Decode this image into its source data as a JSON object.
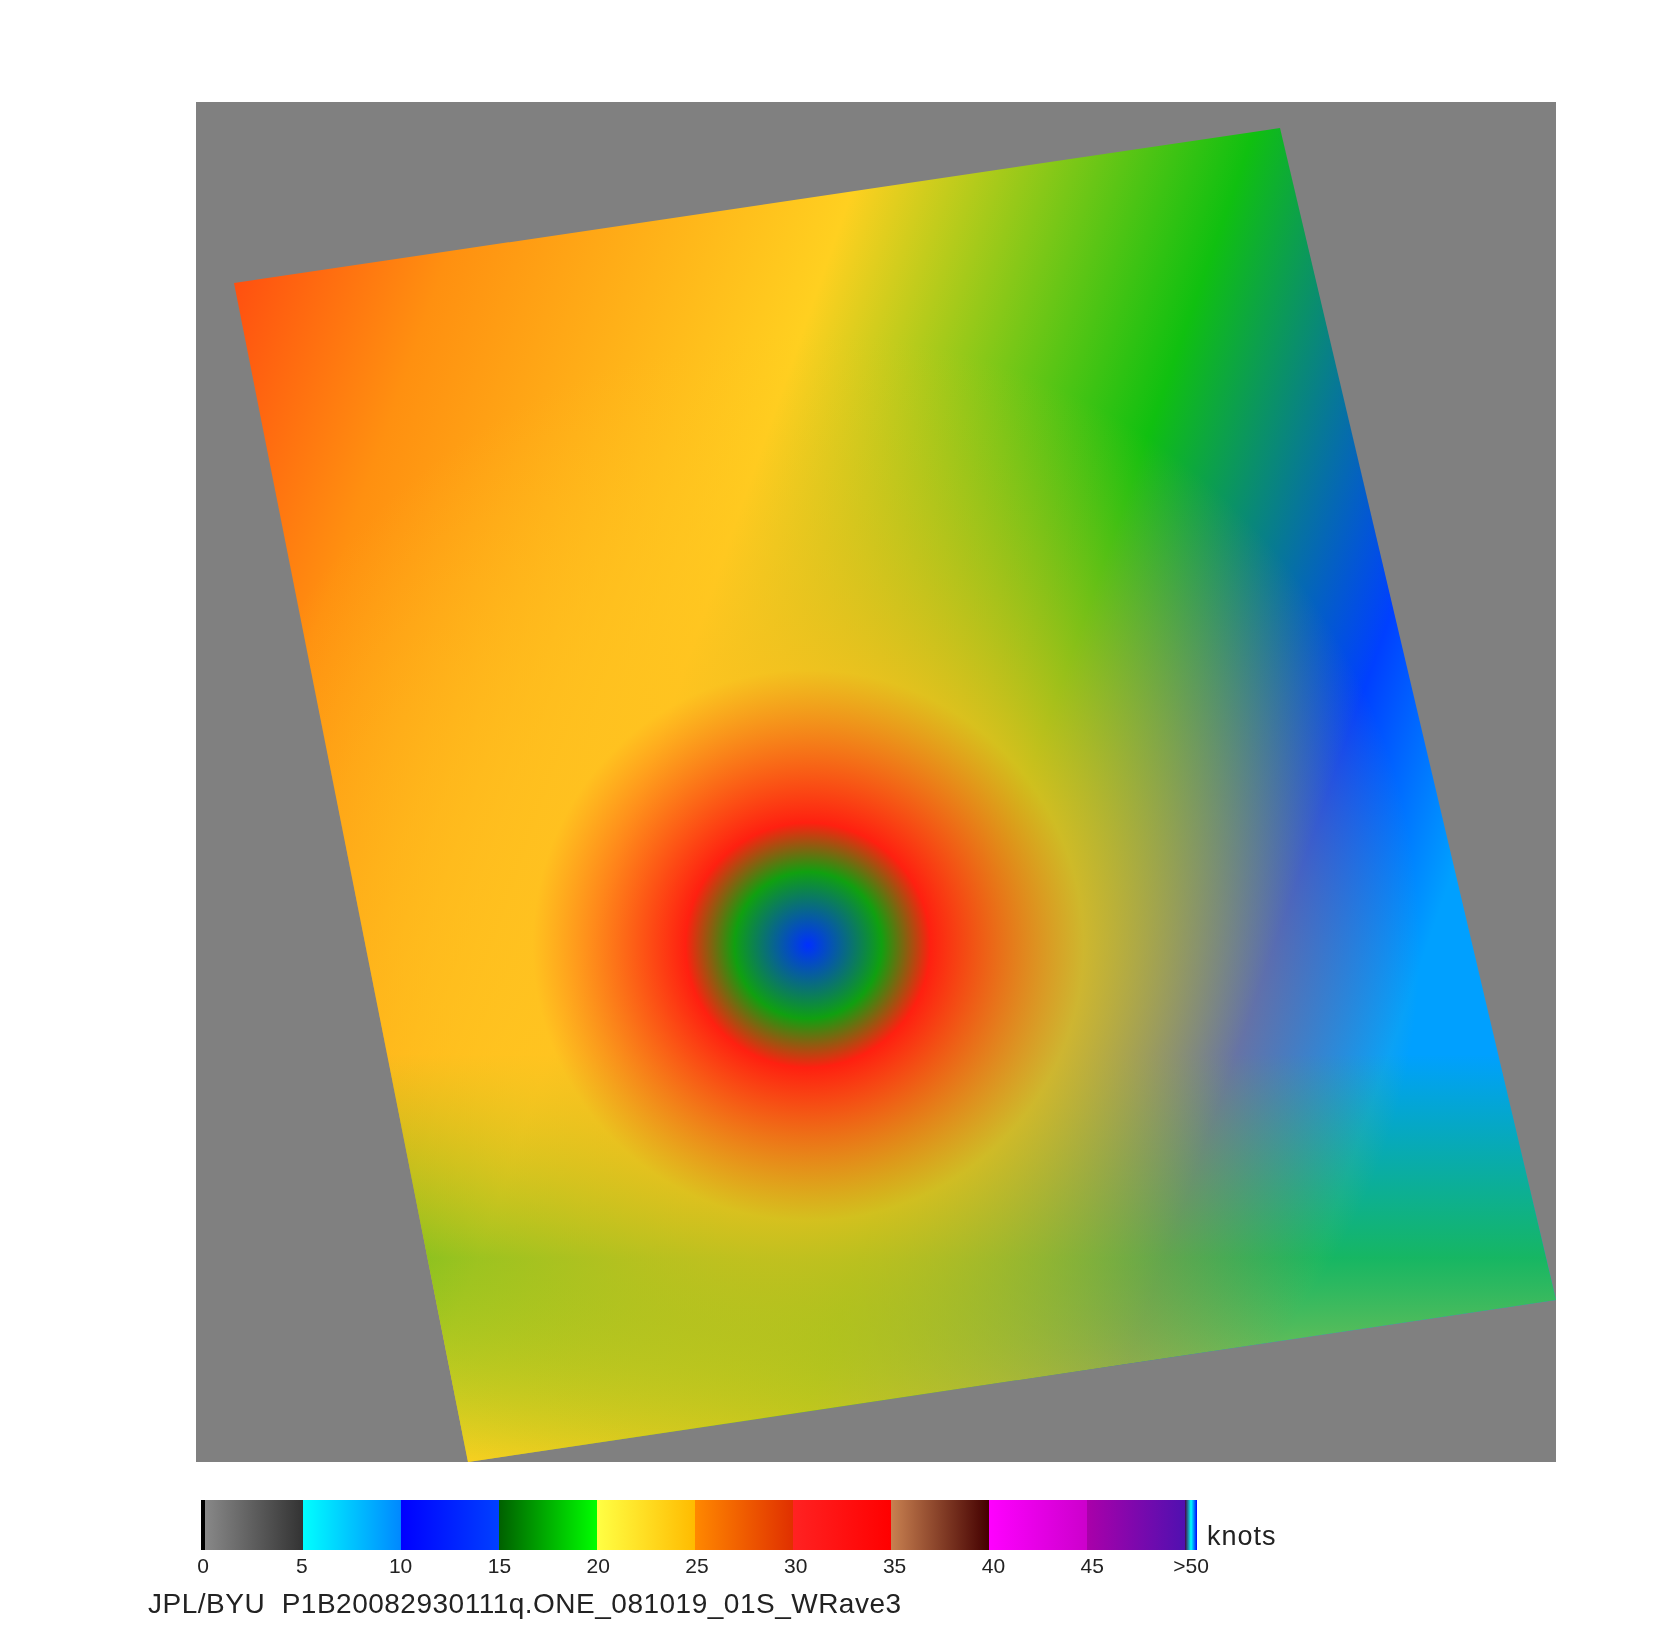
{
  "colorbar": {
    "ticks": [
      "0",
      "5",
      "10",
      "15",
      "20",
      "25",
      "30",
      "35",
      "40",
      "45",
      ">50"
    ],
    "unit": "knots"
  },
  "caption": "JPL/BYU  P1B20082930111q.ONE_081019_01S_WRave3"
}
